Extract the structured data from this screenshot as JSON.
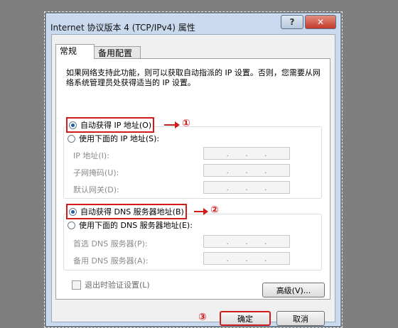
{
  "window": {
    "title": "Internet 协议版本 4 (TCP/IPv4) 属性",
    "help_label": "?",
    "close_label": "✕"
  },
  "tabs": [
    {
      "label": "常规"
    },
    {
      "label": "备用配置"
    }
  ],
  "description": "如果网络支持此功能，则可以获取自动指派的 IP 设置。否则，您需要从网络系统管理员处获得适当的 IP 设置。",
  "ip_section": {
    "auto_label": "自动获得 IP 地址(O)",
    "manual_label": "使用下面的 IP 地址(S):",
    "auto_selected": true,
    "fields": [
      {
        "label": "IP 地址(I):"
      },
      {
        "label": "子网掩码(U):"
      },
      {
        "label": "默认网关(D):"
      }
    ]
  },
  "dns_section": {
    "auto_label": "自动获得 DNS 服务器地址(B)",
    "manual_label": "使用下面的 DNS 服务器地址(E):",
    "auto_selected": true,
    "fields": [
      {
        "label": "首选 DNS 服务器(P):"
      },
      {
        "label": "备用 DNS 服务器(A):"
      }
    ]
  },
  "ip_separator": ".",
  "annotations": {
    "n1": "①",
    "n2": "②",
    "n3": "③"
  },
  "validate_label": "退出时验证设置(L)",
  "advanced_label": "高级(V)...",
  "ok_label": "确定",
  "cancel_label": "取消",
  "colors": {
    "annotation_red": "#d01c1c",
    "selected_radio": "#1d5fa8"
  }
}
